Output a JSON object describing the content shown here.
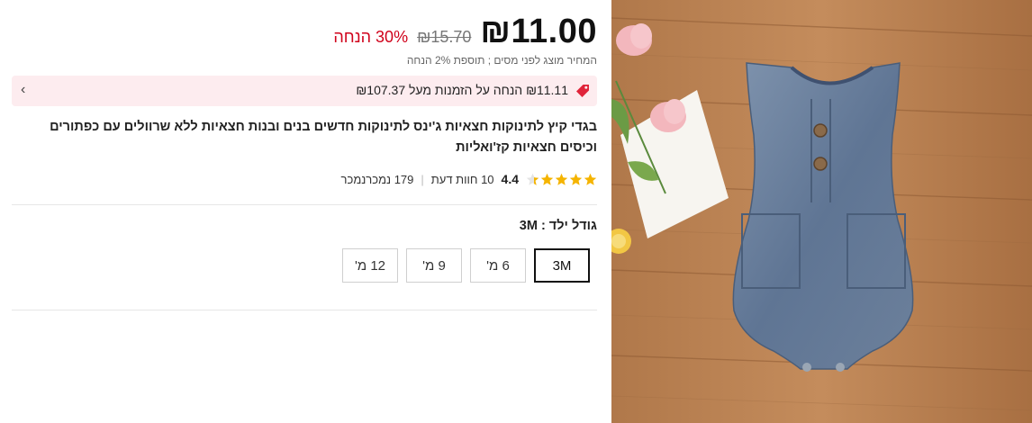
{
  "price": {
    "current": "₪11.00",
    "original": "₪15.70",
    "discount": "30% הנחה",
    "tax_note": "המחיר מוצג לפני מסים ; תוספת 2% הנחה"
  },
  "promo": {
    "text": "₪11.11 הנחה על הזמנות מעל ₪107.37"
  },
  "product": {
    "title": "בגדי קיץ לתינוקות חצאיות ג'ינס לתינוקות חדשים בנים ובנות חצאיות ללא שרוולים עם כפתורים וכיסים חצאיות קז'ואליות"
  },
  "rating": {
    "score": "4.4",
    "stars_filled": 4,
    "reviews": "10 חוות דעת",
    "sold": "179 נמכרנמכר"
  },
  "size": {
    "label": "גודל ילד : 3M",
    "options": [
      "3M",
      "6 מ'",
      "9 מ'",
      "12 מ'"
    ],
    "selected": "3M"
  },
  "colors": {
    "accent": "#d0021b",
    "promo_bg": "#fdecef",
    "star": "#f5b400"
  }
}
